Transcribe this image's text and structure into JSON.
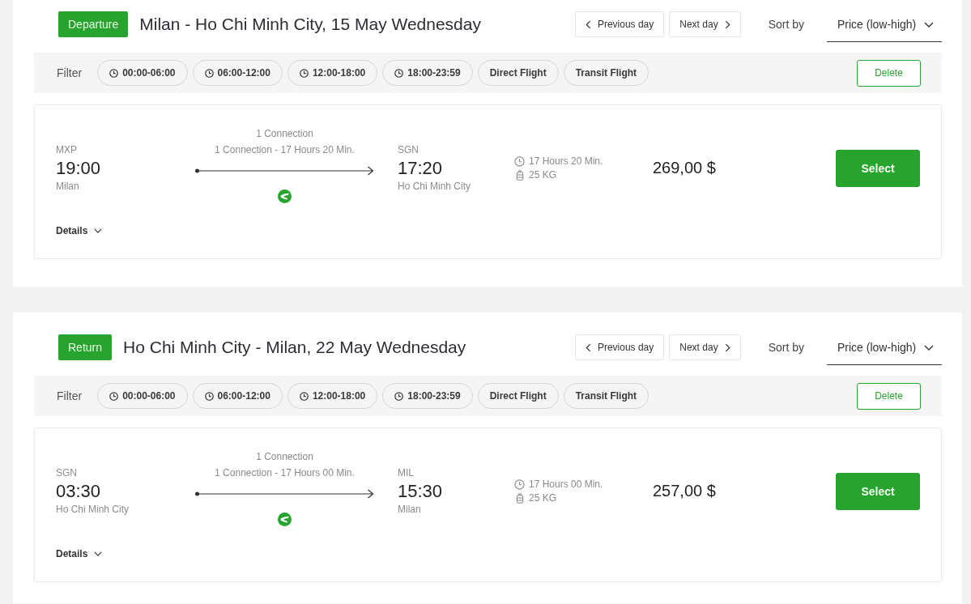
{
  "legs": [
    {
      "badge": "Departure",
      "title": "Milan - Ho Chi Minh City, 15 May Wednesday",
      "prev_day": "Previous day",
      "next_day": "Next day",
      "sort_label": "Sort by",
      "sort_value": "Price (low-high)",
      "filter_label": "Filter",
      "filters": [
        {
          "kind": "time",
          "label": "00:00-06:00",
          "selected": false
        },
        {
          "kind": "time",
          "label": "06:00-12:00",
          "selected": false
        },
        {
          "kind": "time",
          "label": "12:00-18:00",
          "selected": false
        },
        {
          "kind": "time",
          "label": "18:00-23:59",
          "selected": false
        },
        {
          "kind": "type",
          "label": "Direct Flight",
          "selected": false
        },
        {
          "kind": "type",
          "label": "Transit Flight",
          "selected": false
        }
      ],
      "delete": "Delete",
      "flights": [
        {
          "from": {
            "code": "MXP",
            "time": "19:00",
            "city": "Milan"
          },
          "connections": "1 Connection",
          "summary": "1 Connection - 17 Hours 20 Min.",
          "to": {
            "code": "SGN",
            "time": "17:20",
            "city": "Ho Chi Minh City"
          },
          "duration": "17 Hours 20 Min.",
          "baggage": "25 KG",
          "price": "269,00 $",
          "select": "Select",
          "details": "Details",
          "expanded": false
        }
      ]
    },
    {
      "badge": "Return",
      "title": "Ho Chi Minh City - Milan, 22 May Wednesday",
      "prev_day": "Previous day",
      "next_day": "Next day",
      "sort_label": "Sort by",
      "sort_value": "Price (low-high)",
      "filter_label": "Filter",
      "filters": [
        {
          "kind": "time",
          "label": "00:00-06:00",
          "selected": false
        },
        {
          "kind": "time",
          "label": "06:00-12:00",
          "selected": false
        },
        {
          "kind": "time",
          "label": "12:00-18:00",
          "selected": false
        },
        {
          "kind": "time",
          "label": "18:00-23:59",
          "selected": false
        },
        {
          "kind": "type",
          "label": "Direct Flight",
          "selected": false
        },
        {
          "kind": "type",
          "label": "Transit Flight",
          "selected": false
        }
      ],
      "delete": "Delete",
      "flights": [
        {
          "from": {
            "code": "SGN",
            "time": "03:30",
            "city": "Ho Chi Minh City"
          },
          "connections": "1 Connection",
          "summary": "1 Connection - 17 Hours 00 Min.",
          "to": {
            "code": "MIL",
            "time": "15:30",
            "city": "Milan"
          },
          "duration": "17 Hours 00 Min.",
          "baggage": "25 KG",
          "price": "257,00 $",
          "select": "Select",
          "details": "Details",
          "expanded": false
        }
      ]
    }
  ]
}
